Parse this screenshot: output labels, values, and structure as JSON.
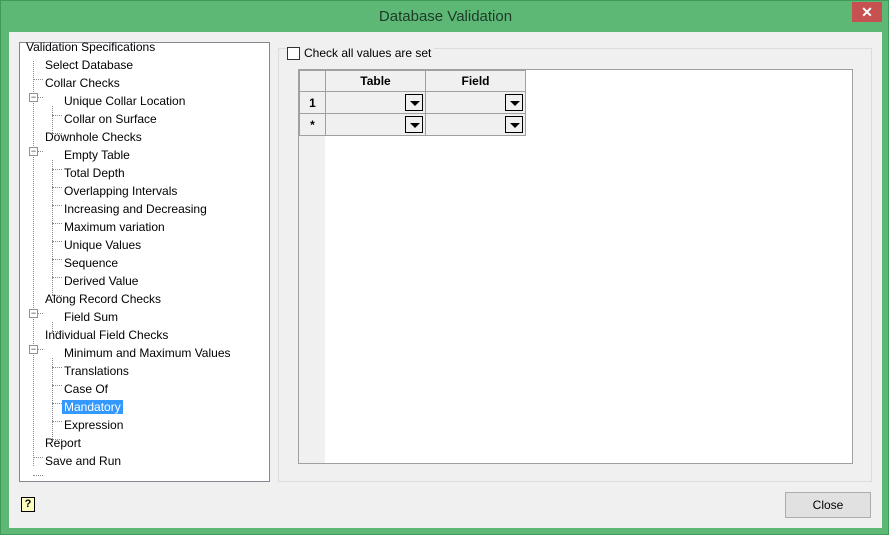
{
  "window": {
    "title": "Database Validation",
    "close_glyph": "✕"
  },
  "tree": {
    "items": [
      {
        "label": "Validation Specifications",
        "level": 0
      },
      {
        "label": "Select Database",
        "level": 1
      },
      {
        "label": "Collar Checks",
        "level": 1,
        "expanded": true
      },
      {
        "label": "Unique Collar Location",
        "level": 2
      },
      {
        "label": "Collar on Surface",
        "level": 2
      },
      {
        "label": "Downhole Checks",
        "level": 1,
        "expanded": true
      },
      {
        "label": "Empty Table",
        "level": 2
      },
      {
        "label": "Total Depth",
        "level": 2
      },
      {
        "label": "Overlapping Intervals",
        "level": 2
      },
      {
        "label": "Increasing and Decreasing",
        "level": 2
      },
      {
        "label": "Maximum variation",
        "level": 2
      },
      {
        "label": "Unique Values",
        "level": 2
      },
      {
        "label": "Sequence",
        "level": 2
      },
      {
        "label": "Derived Value",
        "level": 2
      },
      {
        "label": "Along Record Checks",
        "level": 1,
        "expanded": true
      },
      {
        "label": "Field Sum",
        "level": 2
      },
      {
        "label": "Individual Field Checks",
        "level": 1,
        "expanded": true
      },
      {
        "label": "Minimum and Maximum Values",
        "level": 2
      },
      {
        "label": "Translations",
        "level": 2
      },
      {
        "label": "Case Of",
        "level": 2
      },
      {
        "label": "Mandatory",
        "level": 2,
        "selected": true
      },
      {
        "label": "Expression",
        "level": 2
      },
      {
        "label": "Report",
        "level": 1
      },
      {
        "label": "Save and Run",
        "level": 1
      }
    ]
  },
  "options": {
    "check_all_label": "Check all values are set",
    "check_all_checked": false
  },
  "grid": {
    "columns": [
      "Table",
      "Field"
    ],
    "rows": [
      {
        "header": "1",
        "table": "",
        "field": ""
      },
      {
        "header": "*",
        "table": "",
        "field": ""
      }
    ]
  },
  "footer": {
    "close_label": "Close",
    "help_glyph": "?"
  }
}
